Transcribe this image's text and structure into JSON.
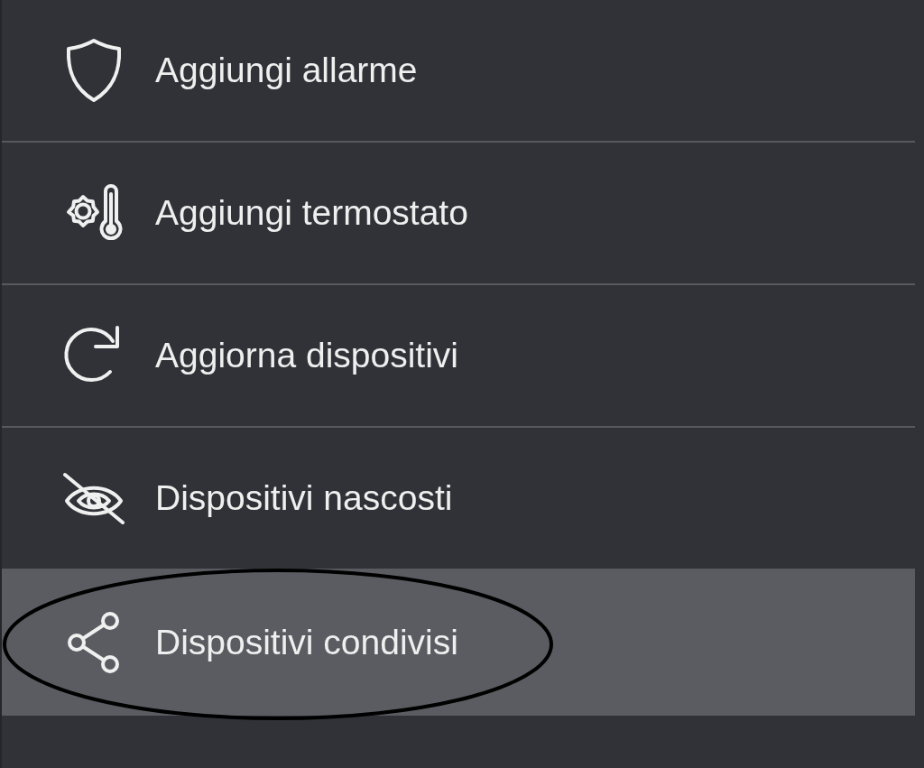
{
  "menu": {
    "items": [
      {
        "label": "Aggiungi allarme",
        "selected": false,
        "circled": false
      },
      {
        "label": "Aggiungi termostato",
        "selected": false,
        "circled": false
      },
      {
        "label": "Aggiorna dispositivi",
        "selected": false,
        "circled": false
      },
      {
        "label": "Dispositivi nascosti",
        "selected": false,
        "circled": false
      },
      {
        "label": "Dispositivi condivisi",
        "selected": true,
        "circled": true
      }
    ]
  }
}
